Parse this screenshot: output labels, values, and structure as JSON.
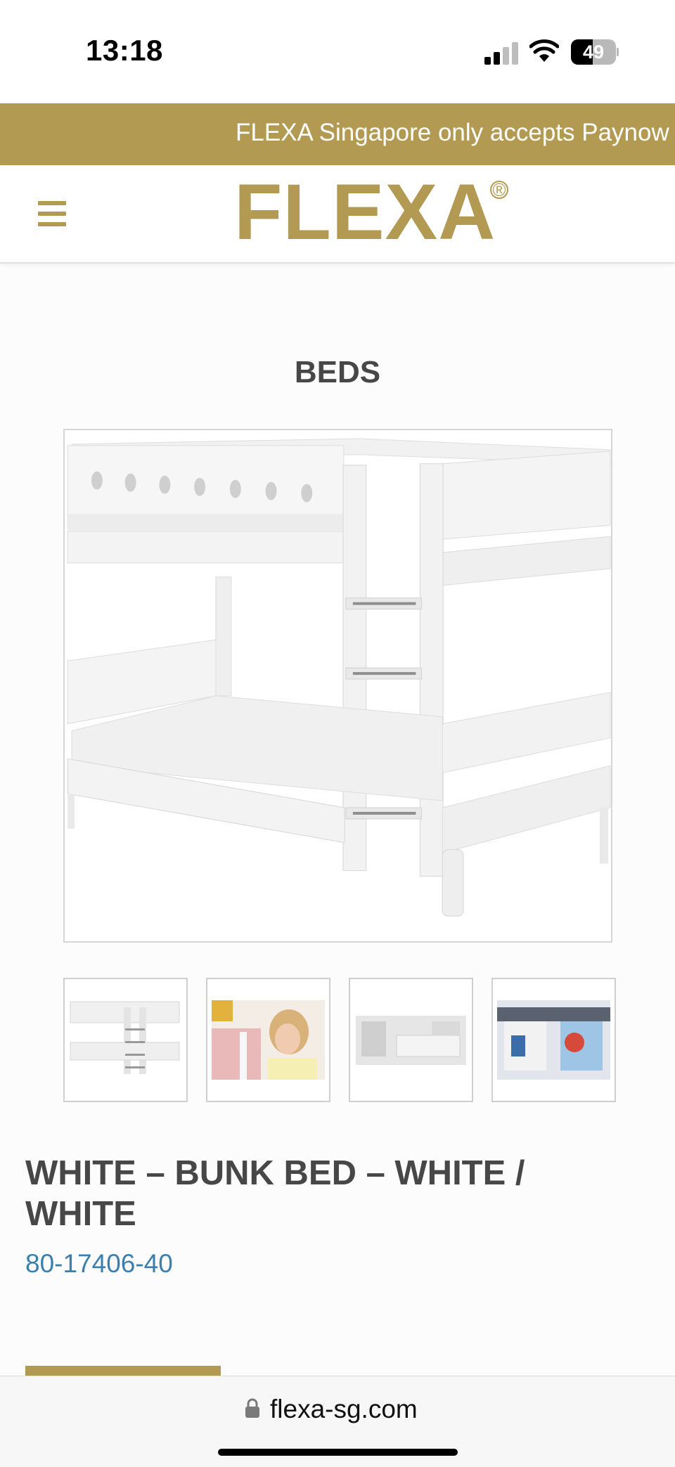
{
  "status_bar": {
    "time": "13:18",
    "battery_level": "49",
    "battery_fraction": 0.49,
    "icons": [
      "signal-icon",
      "wifi-icon",
      "battery-icon"
    ]
  },
  "announcement": {
    "text": "FLEXA Singapore only accepts Paynow p"
  },
  "header": {
    "logo": "FLEXA",
    "logo_mark": "®",
    "menu_icon": "hamburger-menu-icon"
  },
  "category": {
    "heading": "BEDS"
  },
  "gallery": {
    "main_image": "white bunk bed product photo",
    "thumbnails": [
      {
        "label": "bunk bed thumbnail"
      },
      {
        "label": "child with bed thumbnail"
      },
      {
        "label": "bedroom scene thumbnail"
      },
      {
        "label": "bed canopy decor thumbnail"
      }
    ]
  },
  "product": {
    "title": "WHITE – BUNK BED – WHITE / WHITE",
    "sku": "80-17406-40"
  },
  "browser": {
    "url": "flexa-sg.com"
  },
  "colors": {
    "brand_gold": "#b39a53",
    "text_dark": "#474747",
    "link_blue": "#3b7fae"
  }
}
